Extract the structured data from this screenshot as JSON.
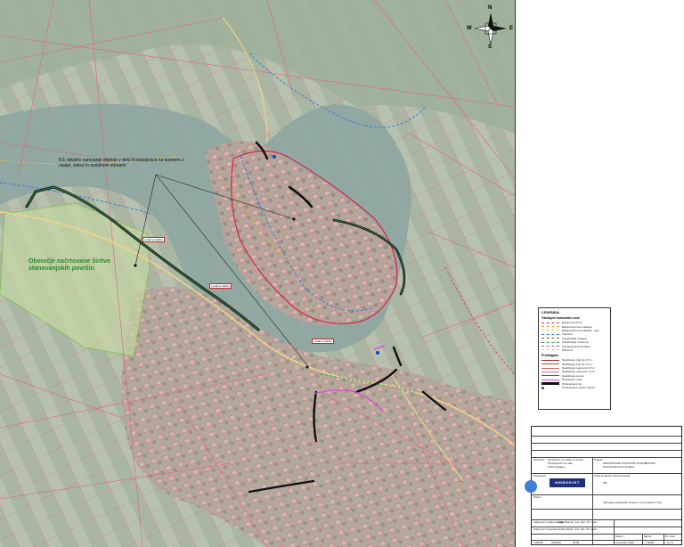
{
  "map": {
    "main_callout": "KS: lokalno varovanje objekte v delu Kostanjevice na kopnem z nasipi, zidovi in mobilnimi stenami",
    "area_label_line1": "Območje načrtovane širitve",
    "area_label_line2": "stanovanjskih površin",
    "small_tag": "Lokalna zaščita",
    "compass_letters": {
      "n": "N",
      "s": "S",
      "e": "E",
      "w": "W"
    }
  },
  "legend": {
    "title": "LEGENDA:",
    "section1": "Obstoječi komunalni vodi",
    "items1": [
      {
        "label": "Elektrovod 20 kV",
        "color": "#d9344a",
        "style": "dashed"
      },
      {
        "label": "Elektronske komunikacije",
        "color": "#f0a020",
        "style": "dashed"
      },
      {
        "label": "Elektronske komunikacije - kab.",
        "color": "#e2c040",
        "style": "dashed"
      },
      {
        "label": "Vodovod",
        "color": "#2a7be0",
        "style": "dashed"
      },
      {
        "label": "Kanalizacija mešana",
        "color": "#8a5a2a",
        "style": "dashed"
      },
      {
        "label": "Kanalizacija meteorna",
        "color": "#2aa84a",
        "style": "dashed"
      },
      {
        "label": "Kanalizacija komunalna",
        "color": "#a04cc0",
        "style": "dashed"
      },
      {
        "label": "Plinovod",
        "color": "#e0d020",
        "style": "dashed"
      }
    ],
    "section2": "Predlagano",
    "items2": [
      {
        "label": "Nadvišanje zidu do 0,5 m",
        "color": "#b02020",
        "style": "solid"
      },
      {
        "label": "Nadvišanje zidu do 1,0 m",
        "color": "#c84040",
        "style": "solid"
      },
      {
        "label": "Nadvišanje nasipa do 0,5 m",
        "color": "#d06060",
        "style": "solid"
      },
      {
        "label": "Nadvišanje nasipa do 1,0 m",
        "color": "#e07070",
        "style": "solid"
      },
      {
        "label": "Nadvišanje terena",
        "color": "#904040",
        "style": "solid"
      },
      {
        "label": "Prestavitev voda",
        "color": "#e040e0",
        "style": "solid"
      },
      {
        "label": "Protipoplavni zid",
        "color": "#1f6a3a",
        "style": "thick"
      },
      {
        "label": "Protipoplavni zaporni ukrepi",
        "color": "#2040c0",
        "style": "dot"
      }
    ]
  },
  "titleblock": {
    "client_label": "Naročnik:",
    "client_line1": "Ministrstvo za okolje in prostor",
    "client_line2": "Direkcija RS za vode",
    "client_line3": "1000 Ljubljana",
    "project_label": "Projekt:",
    "project_line1": "ZMANJŠANJE POPLAVNE OGROŽENOSTI",
    "project_line2": "KOSTANJEVICE NA KRKI",
    "designer_label": "Projektant:",
    "logo_text": "HIDROSVET",
    "phase_label": "Vrsta projektne dokumentacije:",
    "phase_value": "IZP",
    "drawing_label": "Risba:",
    "drawing_value": "Situacija predlaganih ukrepov z komunalnimi vodi",
    "row_a_label": "Odgovorni vodja projekta",
    "row_a_value": "Mitja Rismal, univ. dipl. inž. grad.",
    "row_b_label": "Odgovorni projektant",
    "row_b_value": "Andrej Belič, univ. dipl. inž. grad.",
    "date_label": "Datum:",
    "date_value": "november 2016",
    "scale_label": "Merilo:",
    "scale_value": "1:5000",
    "number_label": "Št. risbe:",
    "number_value": "G.1.1",
    "proj_no": "1185/16",
    "ids_label": "IDZ",
    "ids_value": "2016/14",
    "ident": "ID 65"
  }
}
